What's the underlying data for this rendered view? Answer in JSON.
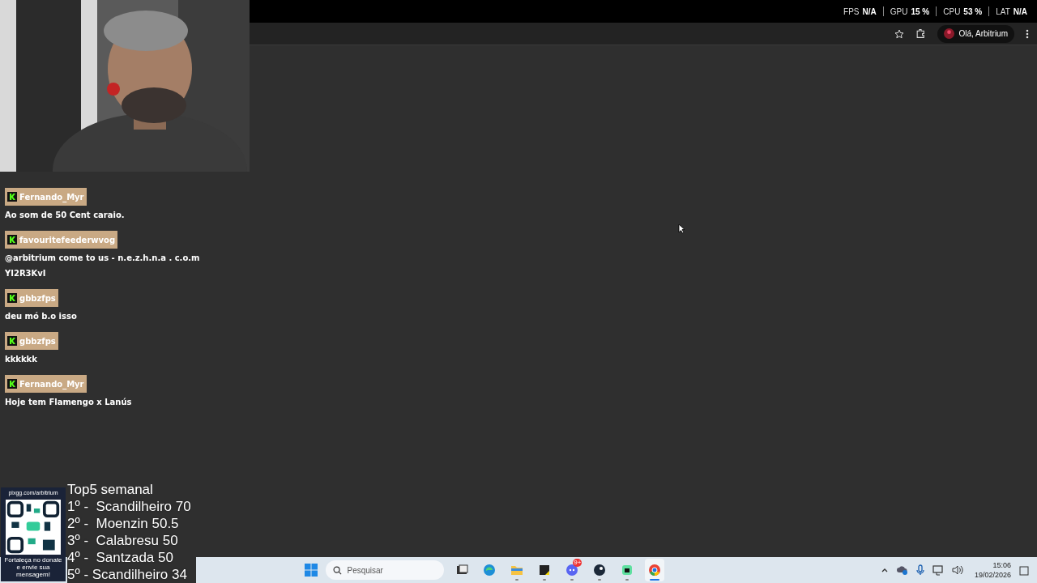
{
  "perf_overlay": [
    {
      "label": "FPS",
      "value": "N/A"
    },
    {
      "label": "GPU",
      "value": "15",
      "unit": "%"
    },
    {
      "label": "CPU",
      "value": "53",
      "unit": "%"
    },
    {
      "label": "LAT",
      "value": "N/A"
    }
  ],
  "browser": {
    "profile_label": "Olá, Arbitrium"
  },
  "chat": {
    "messages": [
      {
        "user": "Fernando_Myr",
        "lines": [
          "Ao som de 50 Cent caraio."
        ]
      },
      {
        "user": "favouritefeederwvog",
        "lines": [
          "@arbitrium come to us - n.e.z.h.n.a . c.o.m",
          "YI2R3KvI"
        ]
      },
      {
        "user": "gbbzfps",
        "lines": [
          "deu mó b.o isso"
        ]
      },
      {
        "user": "gbbzfps",
        "lines": [
          "kkkkkk"
        ]
      },
      {
        "user": "Fernando_Myr",
        "lines": [
          "Hoje tem Flamengo x Lanús"
        ]
      }
    ]
  },
  "donation": {
    "url": "pixgg.com/arbitrium",
    "caption": "Fortaleça no donate e envie sua mensagem!"
  },
  "leaderboard": {
    "title": "Top5 semanal",
    "entries": [
      "1º -  Scandilheiro 70",
      "2º -  Moenzin 50.5",
      "3º -  Calabresu 50",
      "4º -  Santzada 50",
      "5º - Scandilheiro 34"
    ]
  },
  "taskbar": {
    "search_placeholder": "Pesquisar",
    "apps": [
      {
        "kind": "taskview",
        "running": false,
        "selected": false
      },
      {
        "kind": "edge",
        "running": false,
        "selected": false
      },
      {
        "kind": "folder",
        "running": true,
        "selected": false
      },
      {
        "kind": "notes",
        "running": true,
        "selected": false
      },
      {
        "kind": "discord",
        "running": true,
        "selected": false,
        "badge": "9+"
      },
      {
        "kind": "steam",
        "running": true,
        "selected": false
      },
      {
        "kind": "robot",
        "running": true,
        "selected": false
      },
      {
        "kind": "chrome",
        "running": true,
        "selected": true
      }
    ],
    "time": "15:06",
    "date": "19/02/2026"
  }
}
